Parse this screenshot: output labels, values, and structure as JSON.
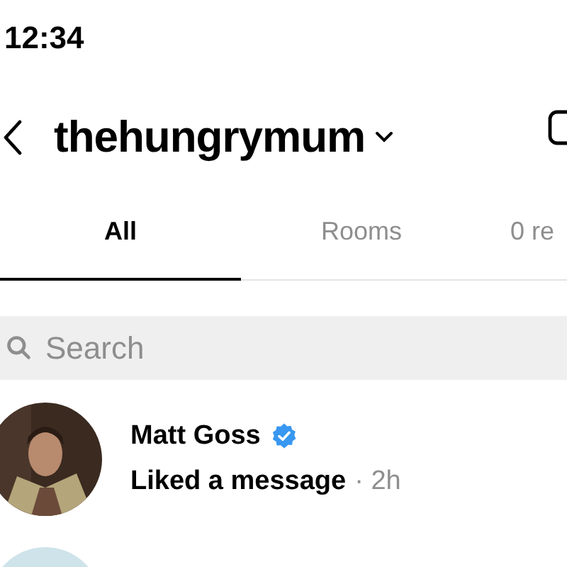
{
  "status_bar": {
    "time": "12:34"
  },
  "header": {
    "username": "thehungrymum"
  },
  "tabs": [
    {
      "label": "All",
      "selected": true
    },
    {
      "label": "Rooms",
      "selected": false
    },
    {
      "label": "0 re",
      "selected": false
    }
  ],
  "search": {
    "placeholder": "Search"
  },
  "conversations": [
    {
      "name": "Matt Goss",
      "verified": true,
      "status": "Liked a message",
      "time": "· 2h",
      "avatar": {
        "kind": "picture"
      }
    },
    {
      "avatar": {
        "kind": "picture"
      }
    }
  ]
}
